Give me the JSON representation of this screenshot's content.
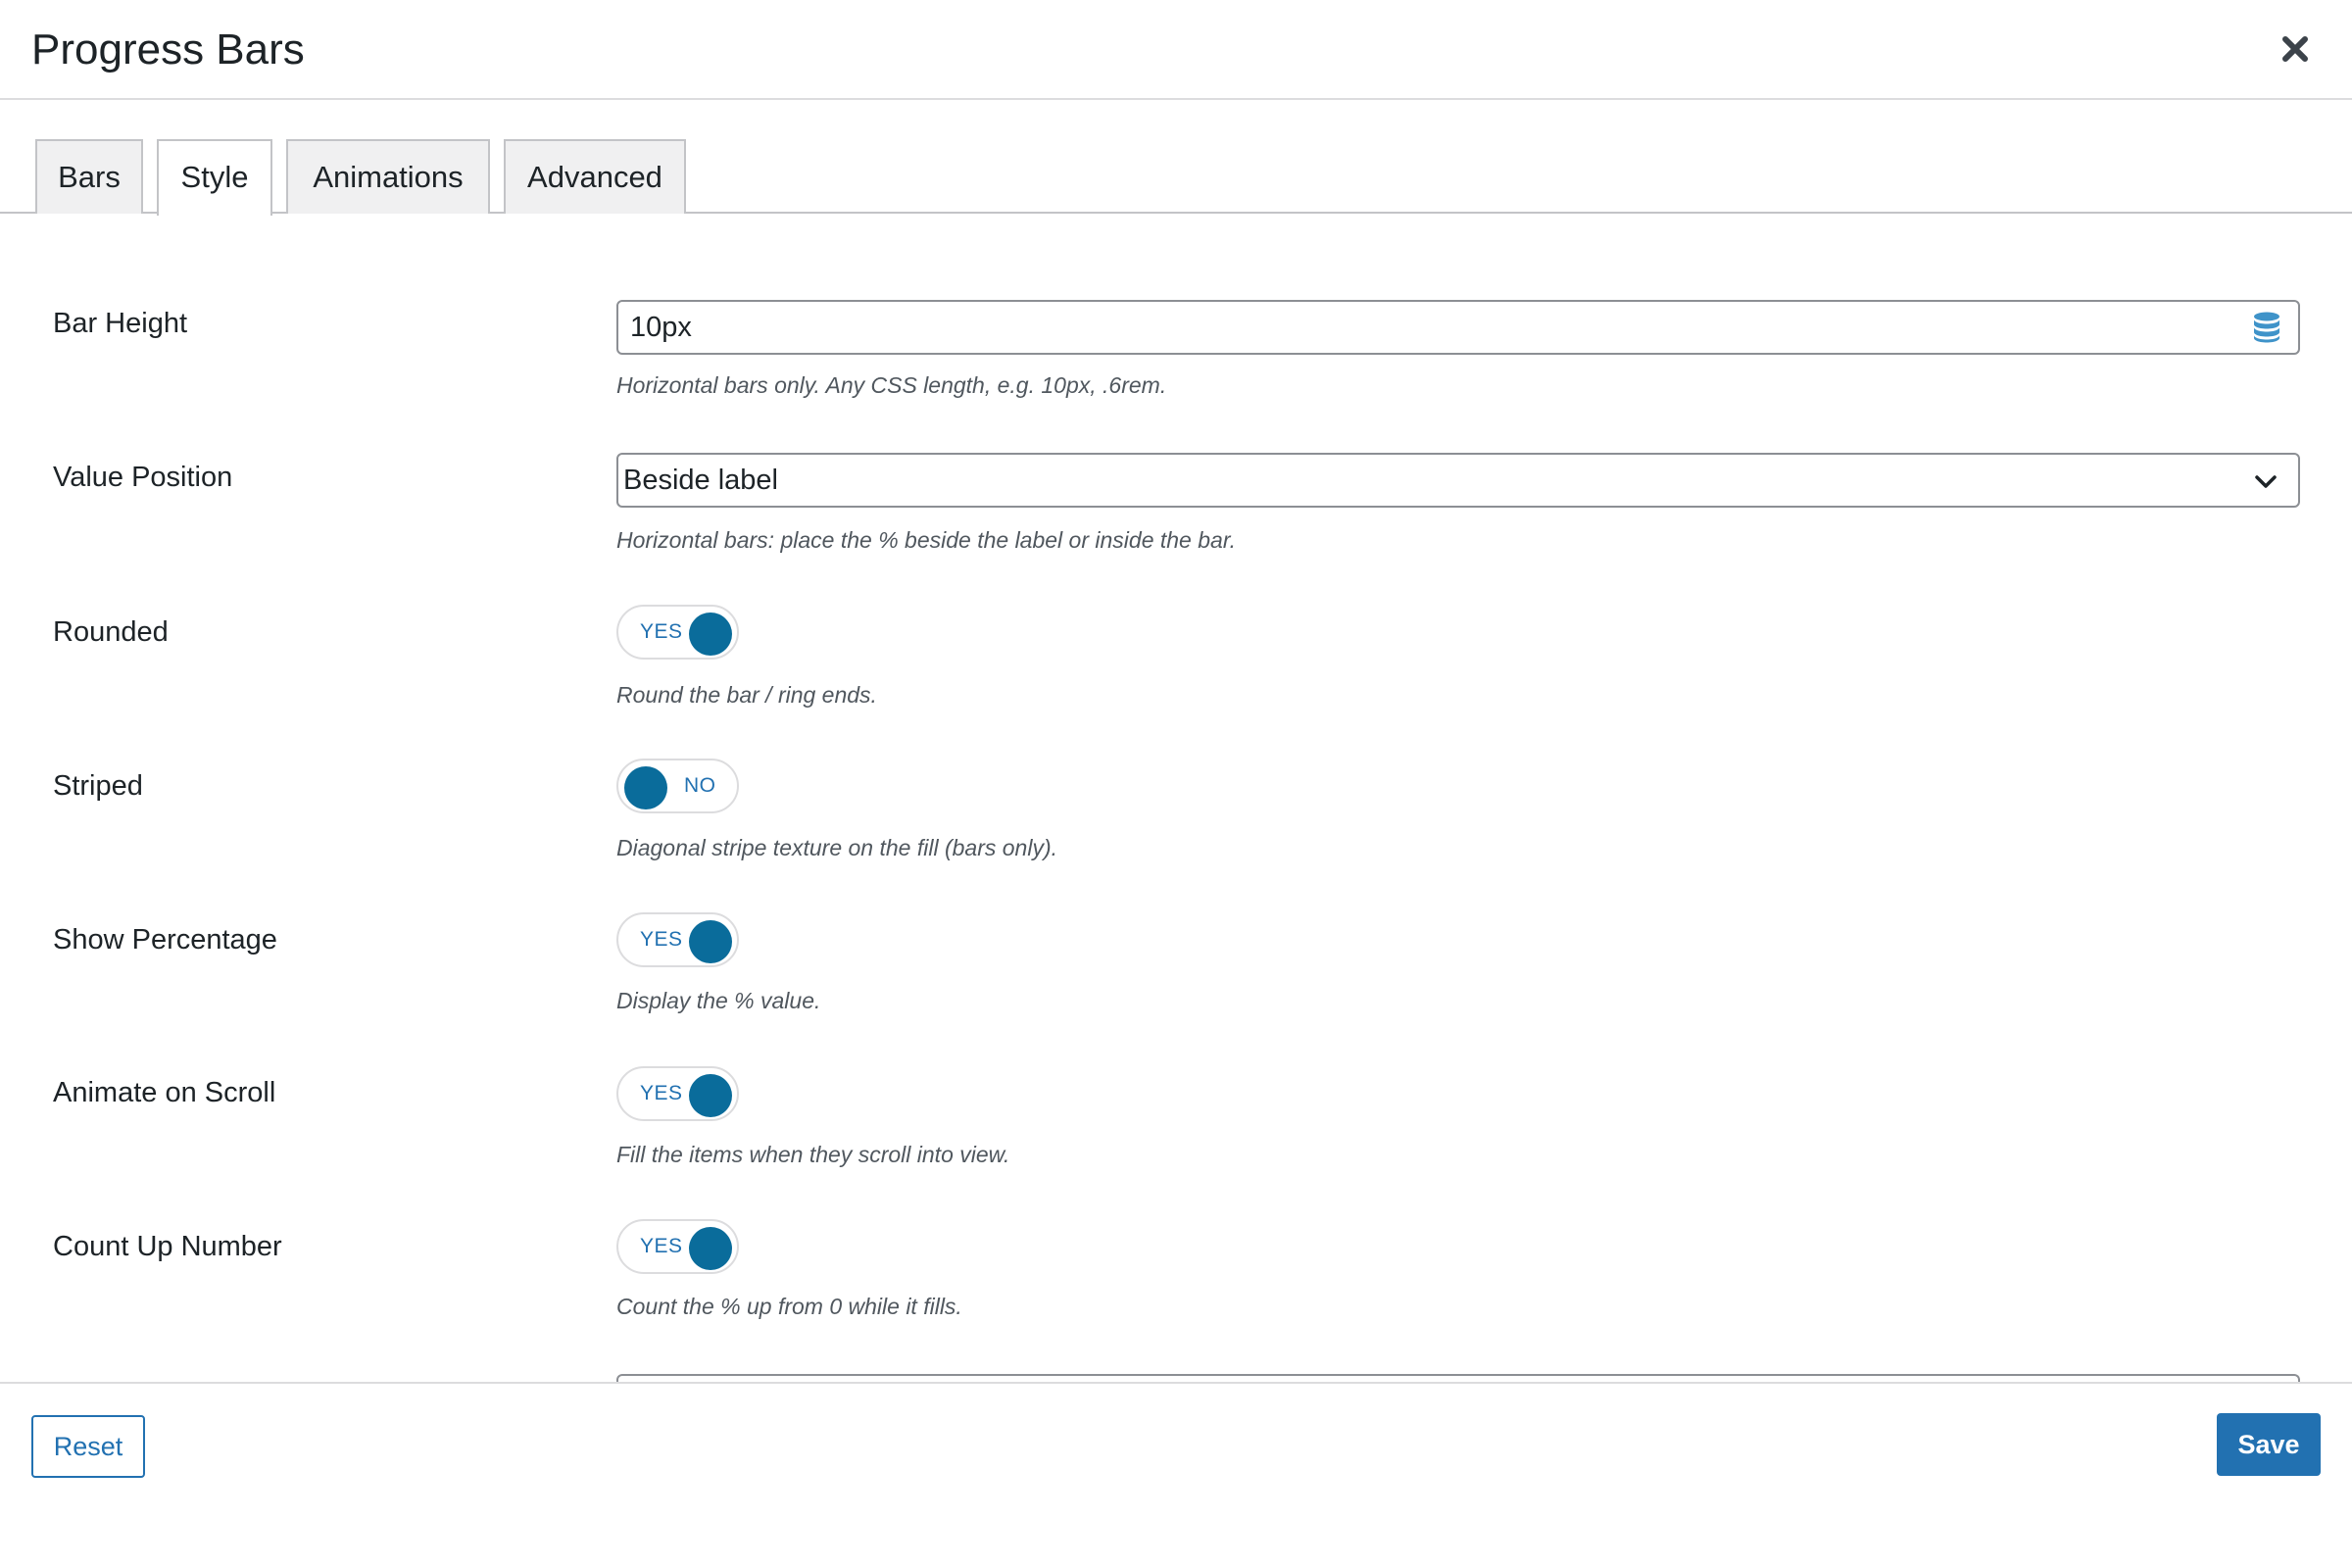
{
  "header": {
    "title": "Progress Bars"
  },
  "tabs": [
    {
      "label": "Bars",
      "active": false
    },
    {
      "label": "Style",
      "active": true
    },
    {
      "label": "Animations",
      "active": false
    },
    {
      "label": "Advanced",
      "active": false
    }
  ],
  "fields": {
    "bar_height": {
      "label": "Bar Height",
      "value": "10px",
      "help": "Horizontal bars only. Any CSS length, e.g. 10px, .6rem.",
      "icon": "database-icon"
    },
    "value_position": {
      "label": "Value Position",
      "selected": "Beside label",
      "help": "Horizontal bars: place the % beside the label or inside the bar."
    },
    "rounded": {
      "label": "Rounded",
      "state": "YES",
      "help": "Round the bar / ring ends."
    },
    "striped": {
      "label": "Striped",
      "state": "NO",
      "help": "Diagonal stripe texture on the fill (bars only)."
    },
    "show_percentage": {
      "label": "Show Percentage",
      "state": "YES",
      "help": "Display the % value."
    },
    "animate_on_scroll": {
      "label": "Animate on Scroll",
      "state": "YES",
      "help": "Fill the items when they scroll into view."
    },
    "count_up_number": {
      "label": "Count Up Number",
      "state": "YES",
      "help": "Count the % up from 0 while it fills."
    }
  },
  "footer": {
    "reset_label": "Reset",
    "save_label": "Save"
  },
  "colors": {
    "accent": "#2271b1",
    "knob": "#0a6c9b",
    "border": "#8c8f94"
  }
}
